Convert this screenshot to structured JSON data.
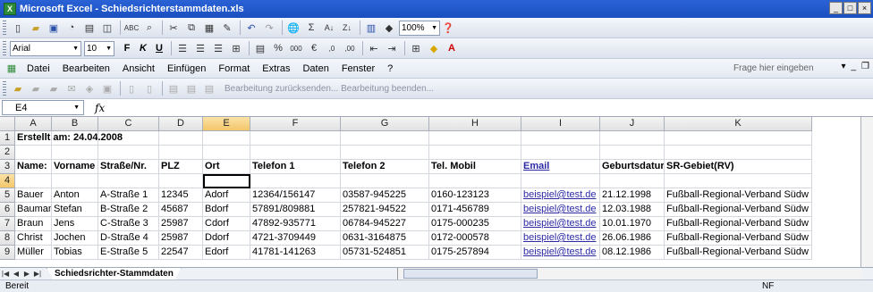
{
  "window": {
    "title": "Microsoft Excel - Schiedsrichterstammdaten.xls",
    "app_icon": "X",
    "buttons": [
      "_",
      "□",
      "×"
    ]
  },
  "toolbar_format": {
    "font": "Arial",
    "size": "10",
    "zoom": "100%"
  },
  "menu": {
    "items": [
      "Datei",
      "Bearbeiten",
      "Ansicht",
      "Einfügen",
      "Format",
      "Extras",
      "Daten",
      "Fenster",
      "?"
    ],
    "help_placeholder": "Frage hier eingeben"
  },
  "review_bar": {
    "text": "Bearbeitung zurücksenden... Bearbeitung beenden..."
  },
  "formula_bar": {
    "cell_ref": "E4",
    "fx": "fx",
    "value": ""
  },
  "grid": {
    "columns": [
      "A",
      "B",
      "C",
      "D",
      "E",
      "F",
      "G",
      "H",
      "I",
      "J",
      "K"
    ],
    "rows": [
      {
        "num": "1",
        "cells": [
          "Erstellt am: 24.04.2008",
          "",
          "",
          "",
          "",
          "",
          "",
          "",
          "",
          "",
          ""
        ]
      },
      {
        "num": "2",
        "cells": [
          "",
          "",
          "",
          "",
          "",
          "",
          "",
          "",
          "",
          "",
          ""
        ]
      },
      {
        "num": "3",
        "cells": [
          "Name:",
          "Vorname",
          "Straße/Nr.",
          "PLZ",
          "Ort",
          "Telefon 1",
          "Telefon 2",
          "Tel. Mobil",
          "Email",
          "Geburtsdatur",
          "SR-Gebiet(RV)"
        ]
      },
      {
        "num": "4",
        "cells": [
          "",
          "",
          "",
          "",
          "",
          "",
          "",
          "",
          "",
          "",
          ""
        ]
      },
      {
        "num": "5",
        "cells": [
          "Bauer",
          "Anton",
          "A-Straße 1",
          "12345",
          "Adorf",
          "12364/156147",
          "03587-945225",
          "0160-123123",
          "beispiel@test.de",
          "21.12.1998",
          "Fußball-Regional-Verband Südw"
        ]
      },
      {
        "num": "6",
        "cells": [
          "Baumann",
          "Stefan",
          "B-Straße 2",
          "45687",
          "Bdorf",
          "57891/809881",
          "257821-94522",
          "0171-456789",
          "beispiel@test.de",
          "12.03.1988",
          "Fußball-Regional-Verband Südw"
        ]
      },
      {
        "num": "7",
        "cells": [
          "Braun",
          "Jens",
          "C-Straße 3",
          "25987",
          "Cdorf",
          "47892-935771",
          "06784-945227",
          "0175-000235",
          "beispiel@test.de",
          "10.01.1970",
          "Fußball-Regional-Verband Südw"
        ]
      },
      {
        "num": "8",
        "cells": [
          "Christ",
          "Jochen",
          "D-Straße 4",
          "25987",
          "Ddorf",
          "4721-3709449",
          "0631-3164875",
          "0172-000578",
          "beispiel@test.de",
          "26.06.1986",
          "Fußball-Regional-Verband Südw"
        ]
      },
      {
        "num": "9",
        "cells": [
          "Müller",
          "Tobias",
          "E-Straße 5",
          "22547",
          "Edorf",
          "41781-141263",
          "05731-524851",
          "0175-257894",
          "beispiel@test.de",
          "08.12.1986",
          "Fußball-Regional-Verband Südw"
        ]
      }
    ]
  },
  "sheet_tabs": {
    "active": "Schiedsrichter-Stammdaten"
  },
  "status": {
    "left": "Bereit",
    "right": "NF"
  }
}
